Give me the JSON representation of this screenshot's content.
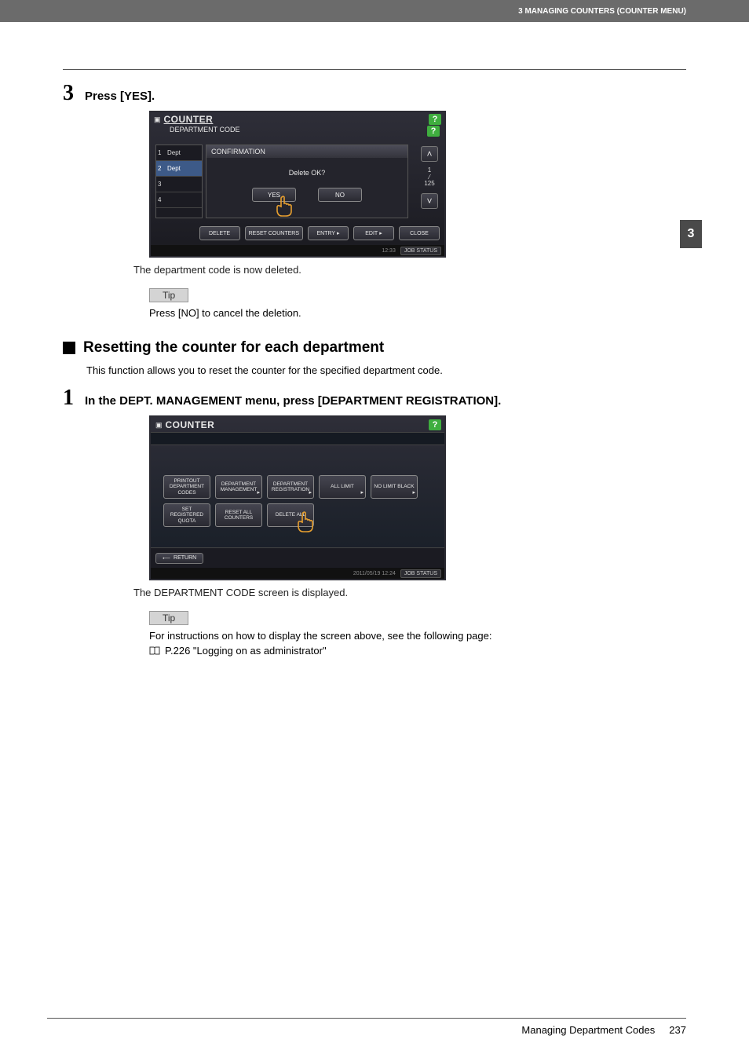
{
  "header": {
    "breadcrumb": "3 MANAGING COUNTERS (COUNTER MENU)"
  },
  "side_tab": "3",
  "step3": {
    "number": "3",
    "instruction": "Press [YES].",
    "result_text": "The department code is now deleted.",
    "tip_label": "Tip",
    "tip_text": "Press [NO] to cancel the deletion."
  },
  "shot1": {
    "title": "COUNTER",
    "subtitle": "DEPARTMENT CODE",
    "help_icon": "?",
    "list": [
      {
        "idx": "1",
        "name": "Dept"
      },
      {
        "idx": "2",
        "name": "Dept"
      },
      {
        "idx": "3",
        "name": ""
      },
      {
        "idx": "4",
        "name": ""
      }
    ],
    "panel_title": "CONFIRMATION",
    "question": "Delete OK?",
    "yes": "YES",
    "no": "NO",
    "pager": {
      "up": "˄",
      "down": "˅",
      "current": "1",
      "total": "125"
    },
    "buttons": {
      "delete": "DELETE",
      "reset": "RESET COUNTERS",
      "entry": "ENTRY",
      "edit": "EDIT",
      "close": "CLOSE"
    },
    "status": {
      "time": "12:33",
      "job": "JOB STATUS"
    }
  },
  "section2": {
    "heading": "Resetting the counter for each department",
    "intro": "This function allows you to reset the counter for the specified department code."
  },
  "step1": {
    "number": "1",
    "instruction": "In the DEPT. MANAGEMENT menu, press [DEPARTMENT REGISTRATION].",
    "result_text": "The DEPARTMENT CODE screen is displayed.",
    "tip_label": "Tip",
    "tip_text": "For instructions on how to display the screen above, see the following page:",
    "link_text": "P.226 \"Logging on as administrator\""
  },
  "shot2": {
    "title": "COUNTER",
    "help_icon": "?",
    "row1": [
      "PRINTOUT DEPARTMENT CODES",
      "DEPARTMENT MANAGEMENT",
      "DEPARTMENT REGISTRATION",
      "ALL LIMIT",
      "NO LIMIT BLACK"
    ],
    "row2": [
      "SET REGISTERED QUOTA",
      "RESET ALL COUNTERS",
      "DELETE ALL"
    ],
    "return": "RETURN",
    "status": {
      "datetime": "2011/05/19 12:24",
      "job": "JOB STATUS"
    }
  },
  "footer": {
    "section": "Managing Department Codes",
    "page": "237"
  }
}
